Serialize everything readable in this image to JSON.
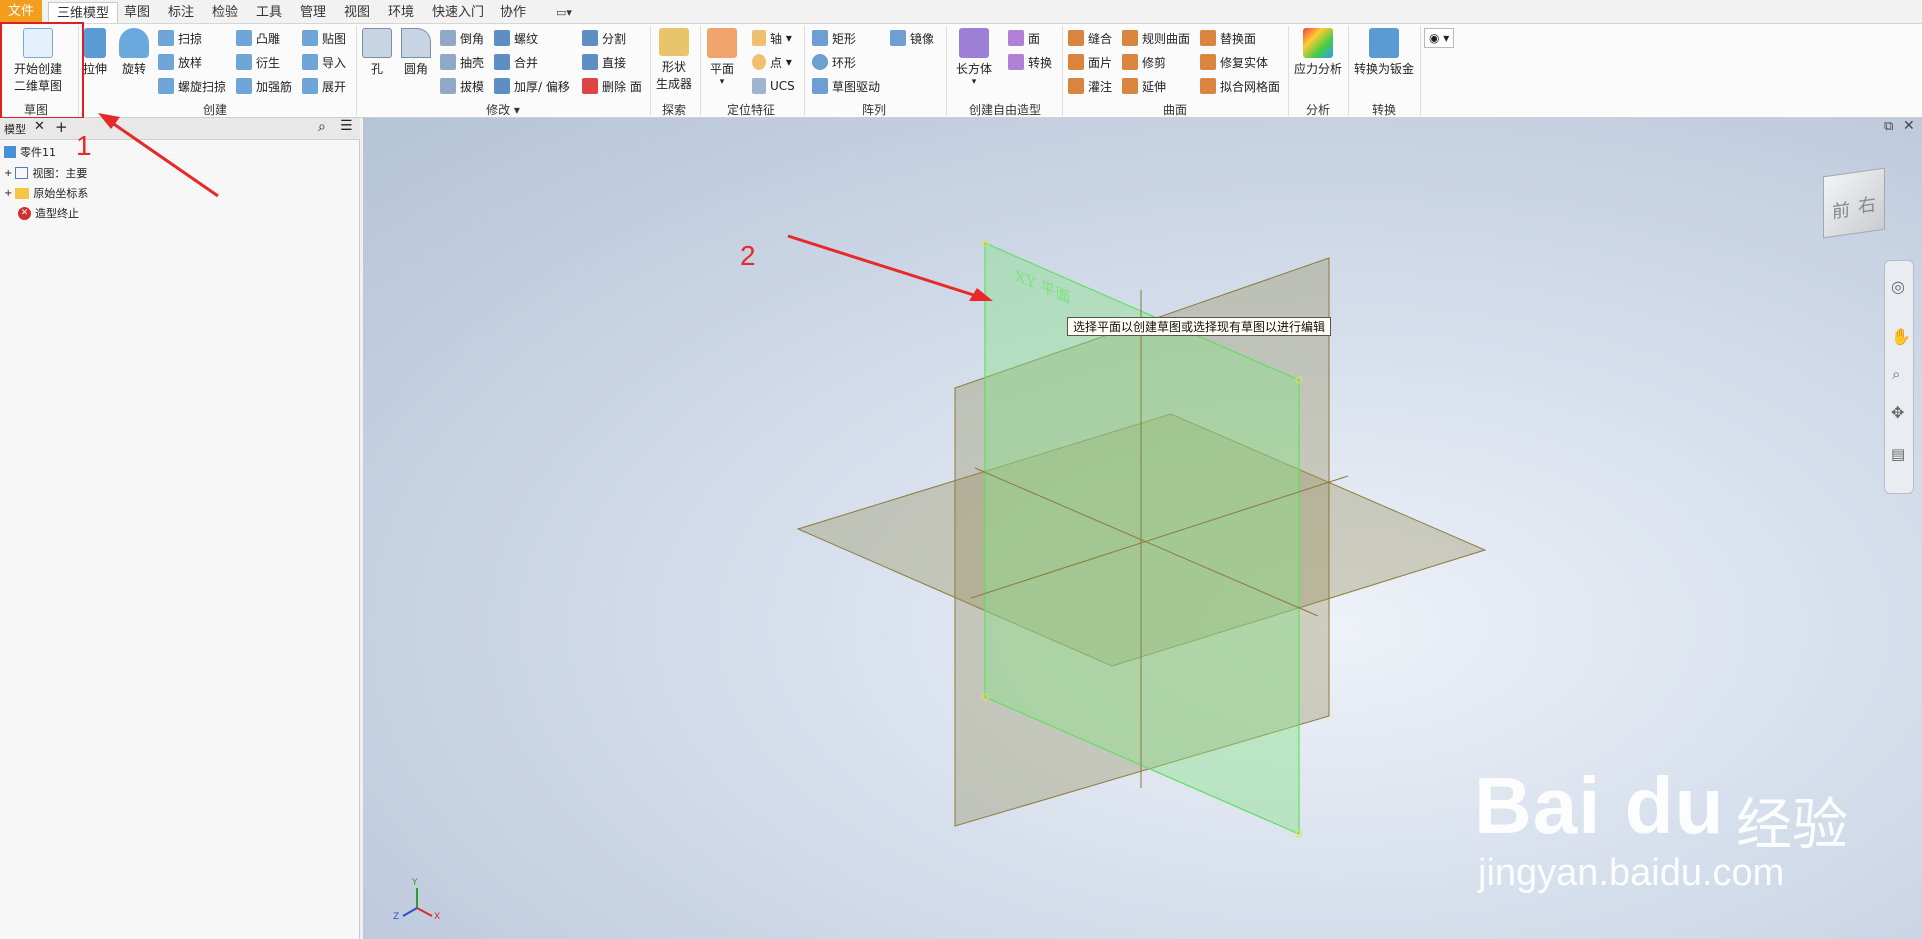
{
  "tabs": [
    "文件",
    "三维模型",
    "草图",
    "标注",
    "检验",
    "工具",
    "管理",
    "视图",
    "环境",
    "快速入门",
    "协作"
  ],
  "ribbon": {
    "sketch": {
      "start_line1": "开始创建",
      "start_line2": "二维草图",
      "group": "草图"
    },
    "create": {
      "extrude": "拉伸",
      "revolve": "旋转",
      "sweep": "扫掠",
      "loft": "放样",
      "coil": "螺旋扫掠",
      "emboss": "凸雕",
      "derive": "衍生",
      "rib": "加强筋",
      "decal": "贴图",
      "import": "导入",
      "unwrap": "展开",
      "group": "创建"
    },
    "modify": {
      "hole": "孔",
      "fillet": "圆角",
      "chamfer": "倒角",
      "shell": "抽壳",
      "draft": "拔模",
      "thread": "螺纹",
      "combine": "合并",
      "thicken": "加厚/ 偏移",
      "split": "分割",
      "direct": "直接",
      "delete_face": "删除 面",
      "group": "修改"
    },
    "explore": {
      "shape_gen1": "形状",
      "shape_gen2": "生成器",
      "group": "探索"
    },
    "work": {
      "plane": "平面",
      "axis": "轴",
      "point": "点",
      "ucs": "UCS",
      "group": "定位特征"
    },
    "pattern": {
      "rect": "矩形",
      "circ": "环形",
      "sketch_driven": "草图驱动",
      "mirror": "镜像",
      "group": "阵列"
    },
    "freeform": {
      "box": "长方体",
      "face": "面",
      "convert": "转换",
      "group": "创建自由造型"
    },
    "surface": {
      "stitch": "缝合",
      "patch": "面片",
      "sculpt": "灌注",
      "ruled": "规则曲面",
      "trim": "修剪",
      "extend": "延伸",
      "replace": "替换面",
      "repair": "修复实体",
      "fit_mesh": "拟合网格面",
      "group": "曲面"
    },
    "analysis": {
      "stress": "应力分析",
      "group": "分析"
    },
    "convert": {
      "to_sheet": "转换为钣金",
      "group": "转换"
    }
  },
  "panel": {
    "tab": "模型",
    "tree": [
      "零件11",
      "视图：主要",
      "原始坐标系",
      "造型终止"
    ]
  },
  "viewport": {
    "tooltip": "选择平面以创建草图或选择现有草图以进行编辑",
    "plane_label": "XY 平面",
    "viewcube_front": "前",
    "viewcube_right": "右",
    "axes": [
      "Y",
      "Z",
      "X"
    ]
  },
  "annotations": {
    "step1": "1",
    "step2": "2"
  },
  "watermark": {
    "brand": "Bai du",
    "brand_cn": "经验",
    "url": "jingyan.baidu.com"
  },
  "colors": {
    "accent": "#f29d1d",
    "highlight": "#e02020",
    "plane_green": "#7ed67e",
    "plane_olive": "#a79a6a"
  }
}
